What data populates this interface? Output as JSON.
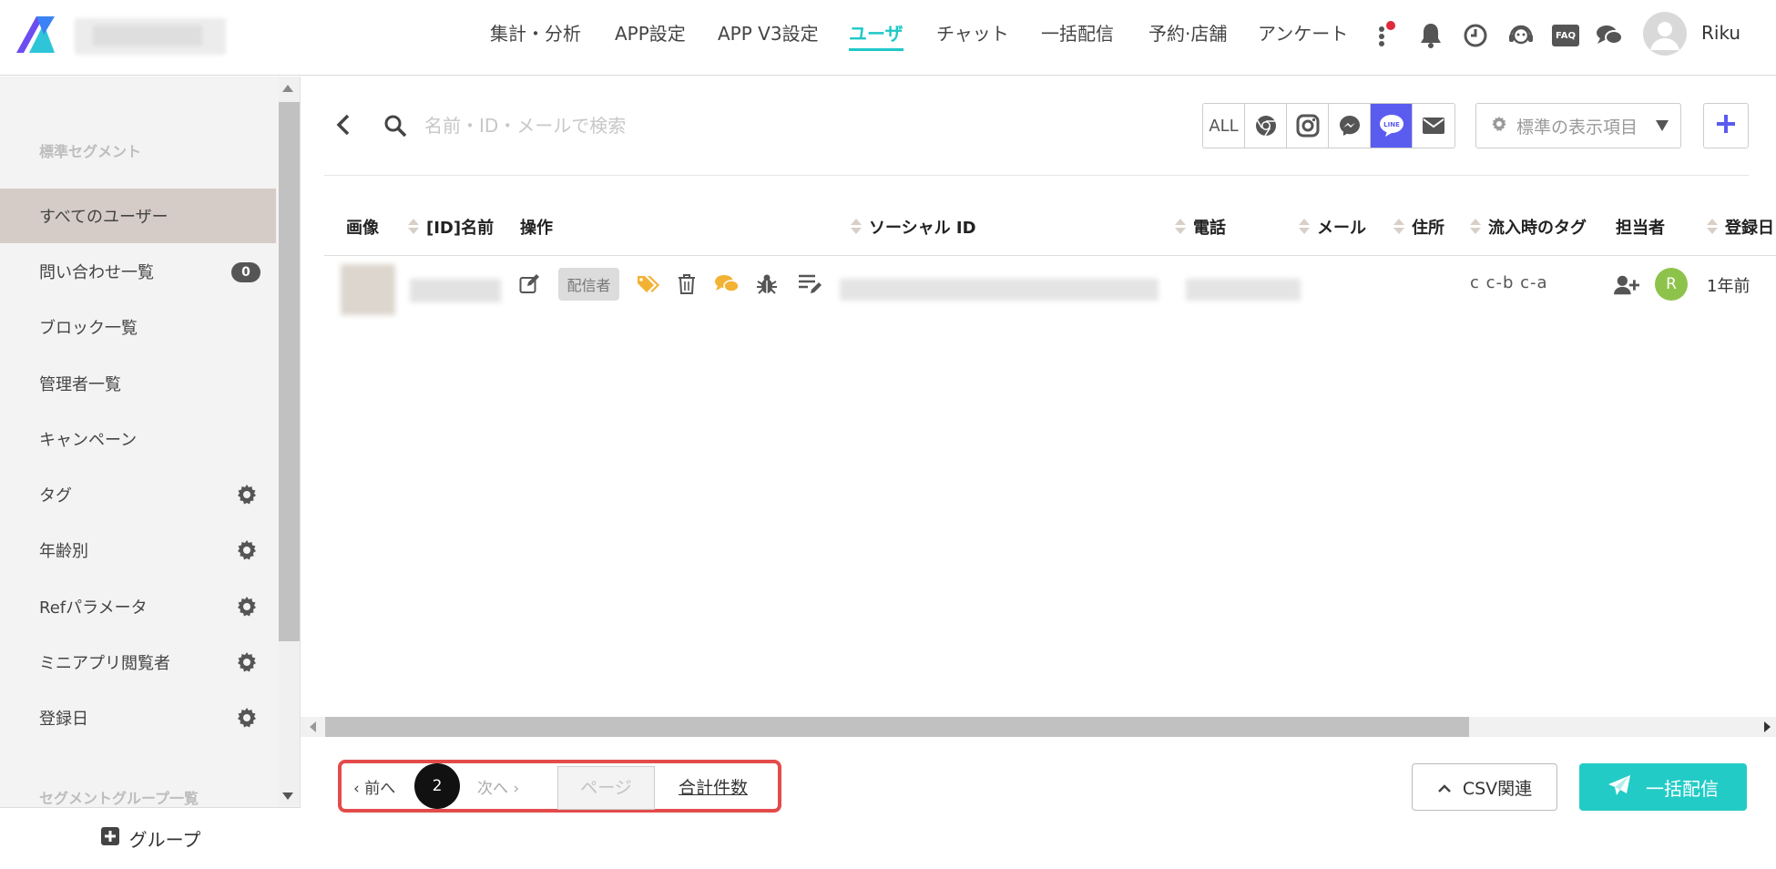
{
  "header": {
    "nav": [
      "集計・分析",
      "APP設定",
      "APP V3設定",
      "ユーザ",
      "チャット",
      "一括配信",
      "予約·店舗",
      "アンケート"
    ],
    "active_nav": "ユーザ",
    "faq_label": "FAQ",
    "username": "Riku",
    "accent_color": "#1ec8c8",
    "icons": [
      "more-vertical-icon",
      "bell-icon",
      "clock-icon",
      "support-headset-icon",
      "faq-icon",
      "chat-bubbles-icon",
      "user-avatar-icon"
    ]
  },
  "sidebar": {
    "heading1": "標準セグメント",
    "items": [
      {
        "label": "すべてのユーザー"
      },
      {
        "label": "問い合わせ一覧",
        "badge": "0"
      },
      {
        "label": "ブロック一覧"
      },
      {
        "label": "管理者一覧"
      },
      {
        "label": "キャンペーン"
      },
      {
        "label": "タグ"
      },
      {
        "label": "年齢別"
      },
      {
        "label": "Refパラメータ"
      },
      {
        "label": "ミニアプリ閲覧者"
      },
      {
        "label": "登録日"
      }
    ],
    "heading2": "セグメントグループ一覧",
    "group_button": "グループ"
  },
  "toolbar": {
    "search_placeholder": "名前・ID・メールで検索",
    "channels": [
      "ALL",
      "chrome-icon",
      "instagram-icon",
      "messenger-icon",
      "line-icon",
      "mail-icon"
    ],
    "active_channel": "line-icon",
    "display_items_label": "標準の表示項目",
    "active_channel_color": "#5a5cf0"
  },
  "table": {
    "columns": [
      "画像",
      "[ID]名前",
      "操作",
      "ソーシャル ID",
      "電話",
      "メール",
      "住所",
      "流入時のタグ",
      "担当者",
      "登録日"
    ],
    "rows": [
      {
        "sender_tag": "配信者",
        "tags": "c c-b c-a",
        "assignee": "R",
        "registered": "1年前"
      }
    ]
  },
  "pagination": {
    "prev": "‹ 前へ",
    "current_page": "2",
    "next": "次へ ›",
    "page_placeholder": "ページ",
    "total_label": "合計件数"
  },
  "footer": {
    "csv_label": "CSV関連",
    "bulk_send_label": "一括配信",
    "bulk_color": "#23cbc6"
  }
}
